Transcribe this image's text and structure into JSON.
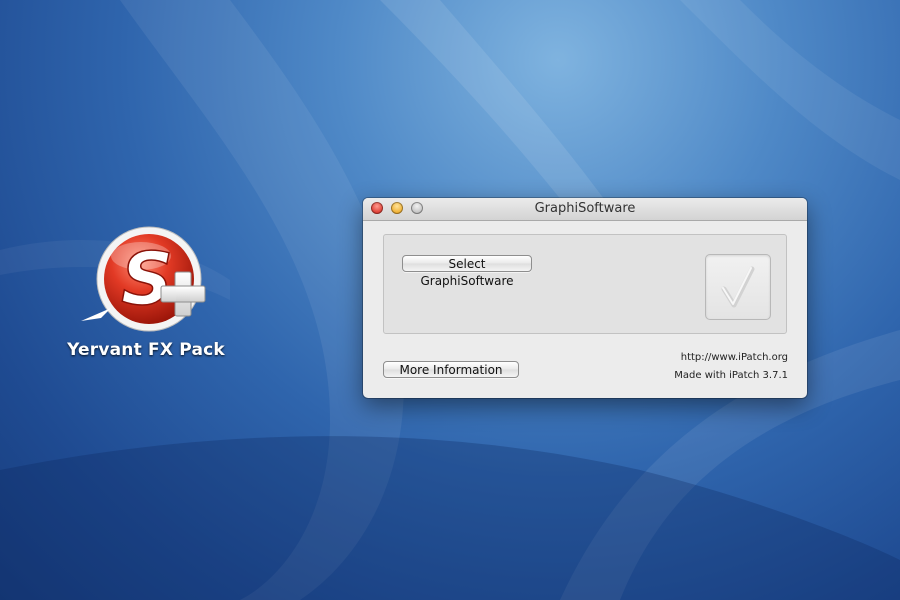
{
  "desktop": {
    "icon": {
      "icon_name": "yervant-s-plus-icon",
      "label": "Yervant FX Pack",
      "glyph": "S"
    }
  },
  "window": {
    "title": "GraphiSoftware",
    "controls": {
      "close": "close-button",
      "minimize": "minimize-button",
      "zoom": "zoom-button"
    },
    "select_button_label": "Select GraphiSoftware",
    "check_icon": "checkmark-icon",
    "more_button_label": "More Information",
    "info_url": "http://www.iPatch.org",
    "made_with": "Made with iPatch 3.7.1"
  },
  "colors": {
    "desktop_blue": "#2f65ad",
    "icon_red": "#d8261b",
    "window_bg": "#ececec"
  }
}
